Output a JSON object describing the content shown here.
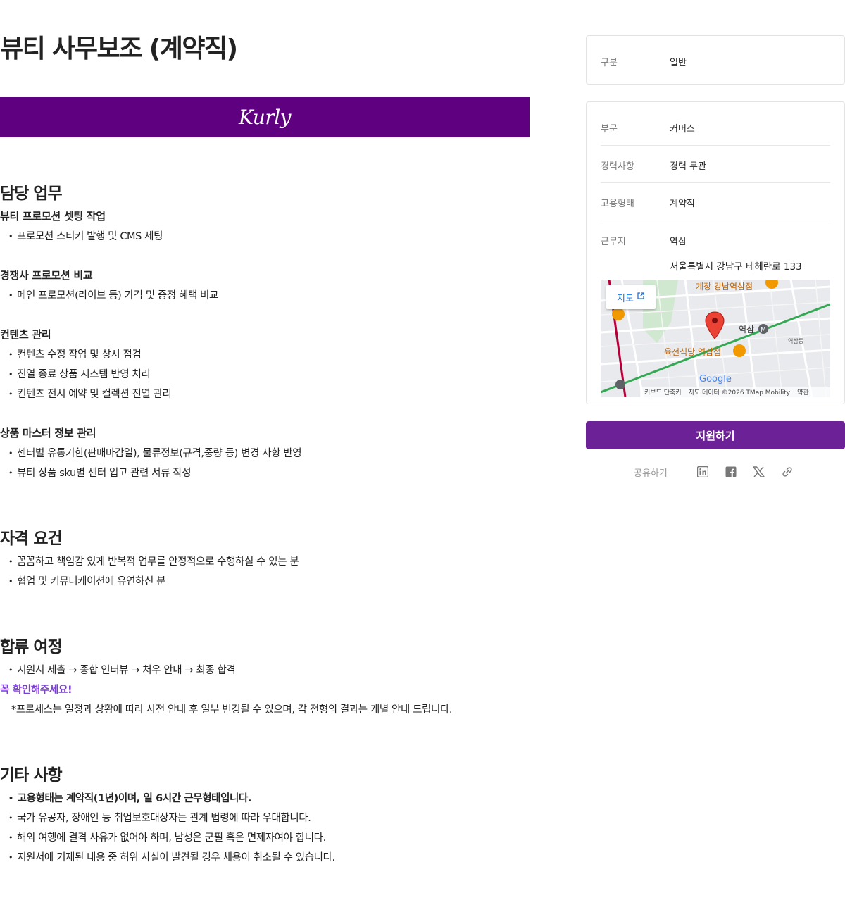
{
  "job": {
    "title": "뷰티 사무보조 (계약직)",
    "banner_logo": "Kurly"
  },
  "sections": {
    "duties": {
      "title": "담당 업무",
      "groups": [
        {
          "title": "뷰티 프로모션 셋팅 작업",
          "items": [
            "프로모션 스티커 발행 및 CMS 세팅"
          ]
        },
        {
          "title": "경쟁사 프로모션 비교",
          "items": [
            "메인 프로모션(라이브 등) 가격 및 증정 혜택 비교"
          ]
        },
        {
          "title": "컨텐츠 관리",
          "items": [
            "컨텐츠 수정 작업 및 상시 점검",
            "진열 종료 상품 시스템 반영 처리",
            "컨텐츠 전시 예약 및 컬렉션 진열 관리"
          ]
        },
        {
          "title": "상품 마스터 정보 관리",
          "items": [
            "센터별 유통기한(판매마감일), 물류정보(규격,중량 등) 변경 사항 반영",
            "뷰티 상품 sku별 센터 입고 관련 서류 작성"
          ]
        }
      ]
    },
    "requirements": {
      "title": "자격 요건",
      "items": [
        "꼼꼼하고 책임감 있게 반복적 업무를 안정적으로 수행하실 수 있는 분",
        "협업 및 커뮤니케이션에 유연하신 분"
      ]
    },
    "process": {
      "title": "합류 여정",
      "items": [
        "지원서 제출 → 종합 인터뷰 → 처우 안내 → 최종 합격"
      ],
      "highlight": "꼭 확인해주세요!",
      "note": "*프로세스는 일정과 상황에 따라 사전 안내 후 일부 변경될 수 있으며, 각 전형의 결과는 개별 안내 드립니다."
    },
    "etc": {
      "title": "기타 사항",
      "items": [
        "고용형태는 계약직(1년)이며, 일 6시간 근무형태입니다.",
        "국가 유공자, 장애인 등 취업보호대상자는 관계 법령에 따라 우대합니다.",
        "해외 여행에 결격 사유가 없어야 하며, 남성은 군필 혹은 면제자여야 합니다.",
        "지원서에 기재된 내용 중 허위 사실이 발견될 경우 채용이 취소될 수 있습니다."
      ]
    }
  },
  "sidebar": {
    "category": {
      "label": "구분",
      "value": "일반"
    },
    "department": {
      "label": "부문",
      "value": "커머스"
    },
    "experience": {
      "label": "경력사항",
      "value": "경력 무관"
    },
    "employment": {
      "label": "고용형태",
      "value": "계약직"
    },
    "location": {
      "label": "근무지",
      "value": "역삼",
      "address": "서울특별시 강남구 테헤란로 133"
    },
    "map": {
      "button_label": "지도",
      "labels": [
        "역삼",
        "육전식당 역삼점",
        "계장 강남역삼점",
        "역삼동",
        "Google"
      ],
      "footer": [
        "키보드 단축키",
        "지도 데이터 ©2026 TMap Mobility",
        "약관"
      ]
    },
    "apply_label": "지원하기",
    "share_label": "공유하기",
    "share_icons": [
      "linkedin-icon",
      "facebook-icon",
      "x-icon",
      "link-icon"
    ]
  },
  "colors": {
    "brand": "#5f0080",
    "button": "#6c2196",
    "highlight": "#7b3fd6"
  }
}
